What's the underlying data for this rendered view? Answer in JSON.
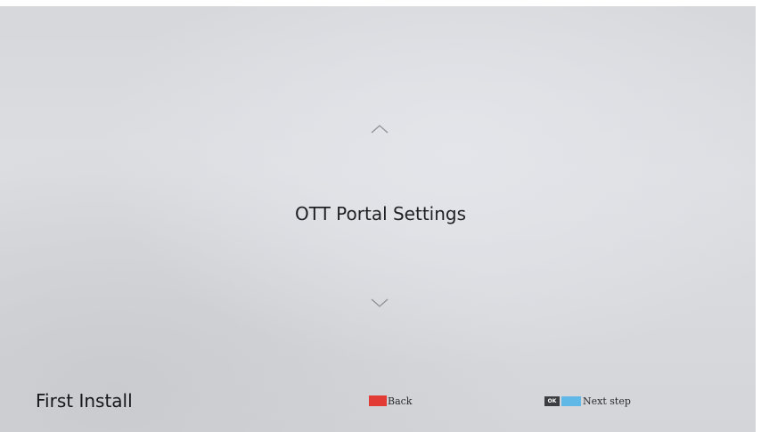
{
  "menu": {
    "current_item": "OTT Portal Settings",
    "up_icon": "chevron-up-icon",
    "down_icon": "chevron-down-icon"
  },
  "footer": {
    "screen_title": "First Install",
    "back": {
      "key_color": "#e23a35",
      "label": "Back"
    },
    "next": {
      "ok_key_label": "OK",
      "key_color": "#5fb8e6",
      "label": "Next step"
    }
  }
}
